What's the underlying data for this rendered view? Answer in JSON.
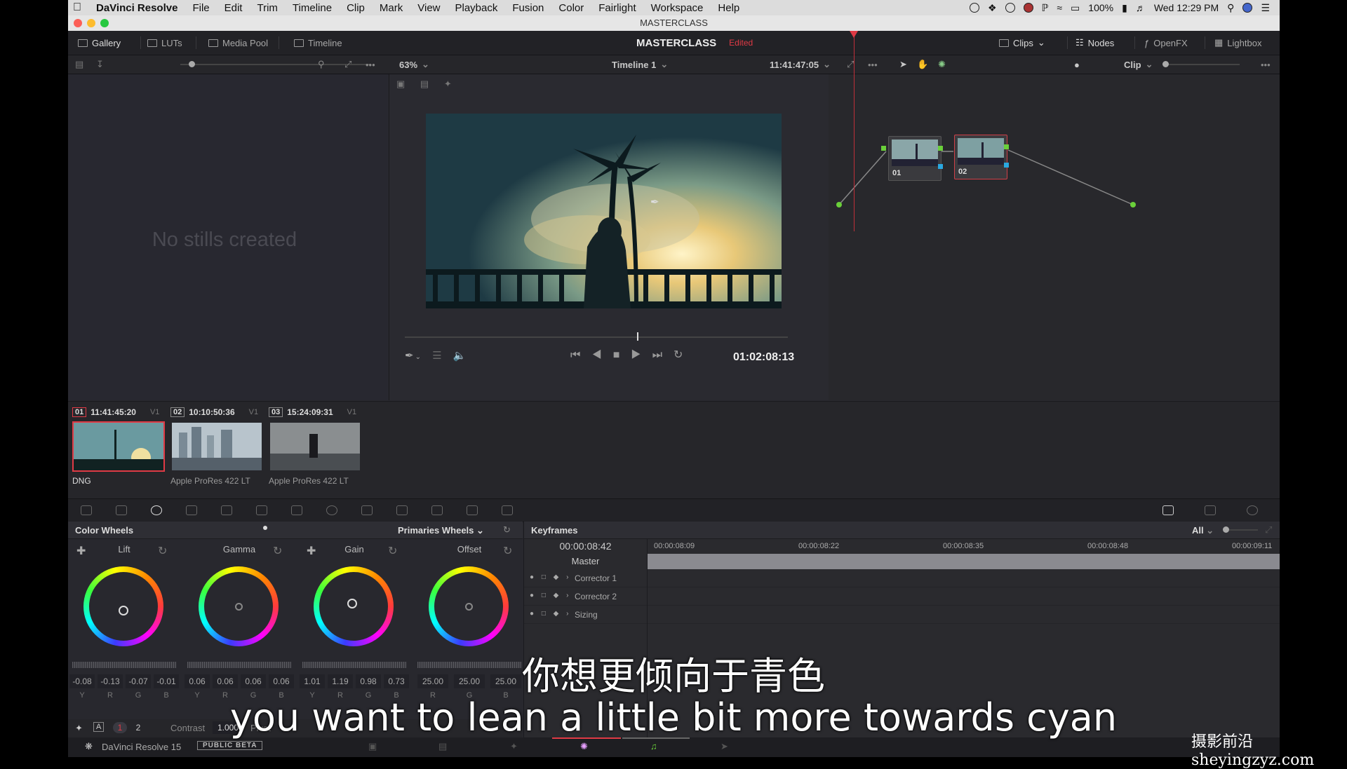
{
  "menubar": {
    "app": "DaVinci Resolve",
    "items": [
      "File",
      "Edit",
      "Trim",
      "Timeline",
      "Clip",
      "Mark",
      "View",
      "Playback",
      "Fusion",
      "Color",
      "Fairlight",
      "Workspace",
      "Help"
    ],
    "battery": "100%",
    "clock": "Wed 12:29 PM"
  },
  "window": {
    "title": "MASTERCLASS"
  },
  "toolbar": {
    "gallery": "Gallery",
    "luts": "LUTs",
    "media_pool": "Media Pool",
    "timeline": "Timeline",
    "project": "MASTERCLASS",
    "project_status": "Edited",
    "clips": "Clips",
    "nodes": "Nodes",
    "openfx": "OpenFX",
    "lightbox": "Lightbox"
  },
  "viewer_bar": {
    "zoom": "63%",
    "timeline_name": "Timeline 1",
    "timecode": "11:41:47:05",
    "clip_mode": "Clip"
  },
  "gallery": {
    "empty": "No stills created"
  },
  "transport": {
    "timecode": "01:02:08:13"
  },
  "nodes": [
    {
      "label": "01"
    },
    {
      "label": "02"
    }
  ],
  "clips": [
    {
      "num": "01",
      "tc": "11:41:45:20",
      "track": "V1",
      "codec": "DNG"
    },
    {
      "num": "02",
      "tc": "10:10:50:36",
      "track": "V1",
      "codec": "Apple ProRes 422 LT"
    },
    {
      "num": "03",
      "tc": "15:24:09:31",
      "track": "V1",
      "codec": "Apple ProRes 422 LT"
    }
  ],
  "wheels": {
    "title": "Color Wheels",
    "mode": "Primaries Wheels",
    "items": [
      {
        "name": "Lift",
        "values": [
          "-0.08",
          "-0.13",
          "-0.07",
          "-0.01"
        ],
        "channels": [
          "Y",
          "R",
          "G",
          "B"
        ]
      },
      {
        "name": "Gamma",
        "values": [
          "0.06",
          "0.06",
          "0.06",
          "0.06"
        ],
        "channels": [
          "Y",
          "R",
          "G",
          "B"
        ]
      },
      {
        "name": "Gain",
        "values": [
          "1.01",
          "1.19",
          "0.98",
          "0.73"
        ],
        "channels": [
          "Y",
          "R",
          "G",
          "B"
        ]
      },
      {
        "name": "Offset",
        "values": [
          "25.00",
          "25.00",
          "25.00"
        ],
        "channels": [
          "R",
          "G",
          "B"
        ]
      }
    ],
    "page1": "1",
    "page2": "2",
    "contrast_label": "Contrast",
    "contrast_value": "1.000",
    "pivot_label": "Pivot"
  },
  "keyframes": {
    "title": "Keyframes",
    "filter": "All",
    "current": "00:00:08:42",
    "ruler": [
      "00:00:08:09",
      "00:00:08:22",
      "00:00:08:35",
      "00:00:08:48",
      "00:00:09:11"
    ],
    "master": "Master",
    "rows": [
      "Corrector 1",
      "Corrector 2",
      "Sizing"
    ]
  },
  "status": {
    "app": "DaVinci Resolve 15",
    "badge": "PUBLIC BETA"
  },
  "subtitles": {
    "cn": "你想更倾向于青色",
    "en": "you want to lean a little bit more towards cyan"
  },
  "watermark": "摄影前沿 sheyingzyz.com",
  "colors": {
    "accent_red": "#e03a45",
    "node_green": "#6ad03a",
    "node_blue": "#2aa8e0"
  }
}
